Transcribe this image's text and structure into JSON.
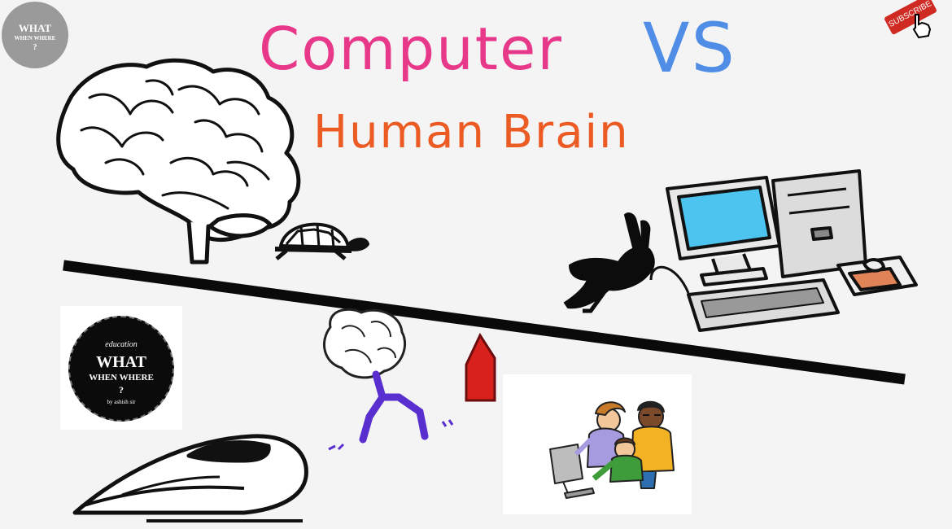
{
  "title": {
    "line1": "Computer",
    "line1_vs": "VS",
    "line2": "Human Brain"
  },
  "channel_badge": {
    "word1": "WHAT",
    "word2": "WHEN WHERE",
    "word3": "?"
  },
  "logo": {
    "tagline": "education",
    "word1": "WHAT",
    "word2": "WHEN WHERE",
    "word3": "?",
    "byline": "by ashish sir"
  },
  "subscribe_button": "SUBSCRIBE",
  "colors": {
    "computer": "#e8388a",
    "vs": "#4f8de6",
    "human_brain": "#ec5b24",
    "marker": "#d8201c",
    "monitor_screen": "#4cc4ef"
  },
  "icons": [
    "brain-icon",
    "turtle-icon",
    "rabbit-icon",
    "computer-icon",
    "running-brain-icon",
    "bullet-train-icon",
    "people-at-computer-icon",
    "seesaw-beam",
    "fulcrum-marker"
  ]
}
